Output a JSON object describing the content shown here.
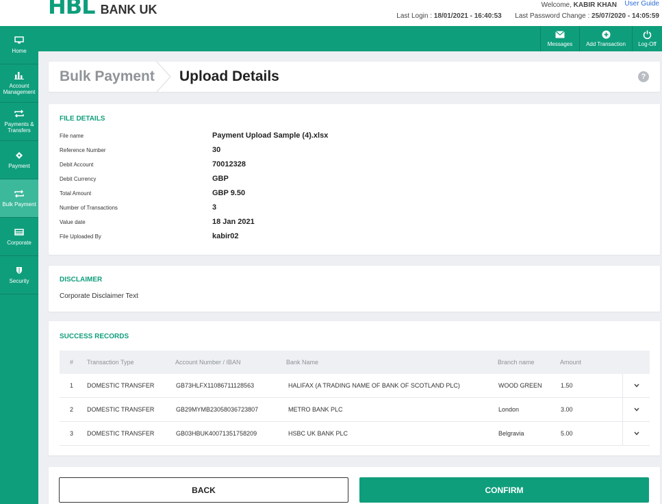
{
  "header": {
    "logo_mark": "HBL",
    "logo_text": "BANK UK",
    "welcome_prefix": "Welcome,",
    "user_name": "KABIR KHAN",
    "user_guide": "User Guide",
    "last_login_label": "Last Login :",
    "last_login_value": "18/01/2021 - 16:40:53",
    "last_pw_label": "Last Password Change :",
    "last_pw_value": "25/07/2020 - 14:05:59"
  },
  "sidebar": {
    "items": [
      {
        "label": "Home",
        "icon": "monitor-icon"
      },
      {
        "label": "Account Management",
        "icon": "bar-chart-icon"
      },
      {
        "label": "Payments & Transfers",
        "icon": "transfer-arrows-icon"
      },
      {
        "label": "Payment",
        "icon": "payment-tag-icon"
      },
      {
        "label": "Bulk Payment",
        "icon": "transfer-arrows-icon",
        "active": true
      },
      {
        "label": "Corporate",
        "icon": "list-icon"
      },
      {
        "label": "Security",
        "icon": "shield-icon"
      }
    ]
  },
  "actions": {
    "messages": "Messages",
    "add_transaction": "Add Transaction",
    "log_off": "Log-Off"
  },
  "breadcrumb": {
    "first": "Bulk Payment",
    "second": "Upload Details",
    "help": "?"
  },
  "file_details": {
    "title": "FILE DETAILS",
    "rows": [
      {
        "label": "File name",
        "value": "Payment Upload Sample (4).xlsx"
      },
      {
        "label": "Reference Number",
        "value": "30"
      },
      {
        "label": "Debit Account",
        "value": "70012328"
      },
      {
        "label": "Debit Currency",
        "value": "GBP"
      },
      {
        "label": "Total Amount",
        "value": "GBP 9.50"
      },
      {
        "label": "Number of Transactions",
        "value": "3"
      },
      {
        "label": "Value date",
        "value": "18 Jan 2021"
      },
      {
        "label": "File Uploaded By",
        "value": "kabir02"
      }
    ]
  },
  "disclaimer": {
    "title": "DISCLAIMER",
    "text": "Corporate Disclaimer Text"
  },
  "success_records": {
    "title": "SUCCESS RECORDS",
    "columns": [
      "#",
      "Transaction Type",
      "Account Number / IBAN",
      "Bank Name",
      "Branch name",
      "Amount"
    ],
    "rows": [
      {
        "num": "1",
        "type": "DOMESTIC TRANSFER",
        "account": "GB73HLFX11086711128563",
        "bank": "HALIFAX (A TRADING NAME OF BANK OF SCOTLAND PLC)",
        "branch": "WOOD GREEN",
        "amount": "1.50"
      },
      {
        "num": "2",
        "type": "DOMESTIC TRANSFER",
        "account": "GB29MYMB23058036723807",
        "bank": "METRO BANK PLC",
        "branch": "London",
        "amount": "3.00"
      },
      {
        "num": "3",
        "type": "DOMESTIC TRANSFER",
        "account": "GB03HBUK40071351758209",
        "bank": "HSBC UK BANK PLC",
        "branch": "Belgravia",
        "amount": "5.00"
      }
    ]
  },
  "buttons": {
    "back": "BACK",
    "confirm": "CONFIRM"
  },
  "colors": {
    "brand_green": "#0f9e7c",
    "active_green": "#3cb89a"
  }
}
